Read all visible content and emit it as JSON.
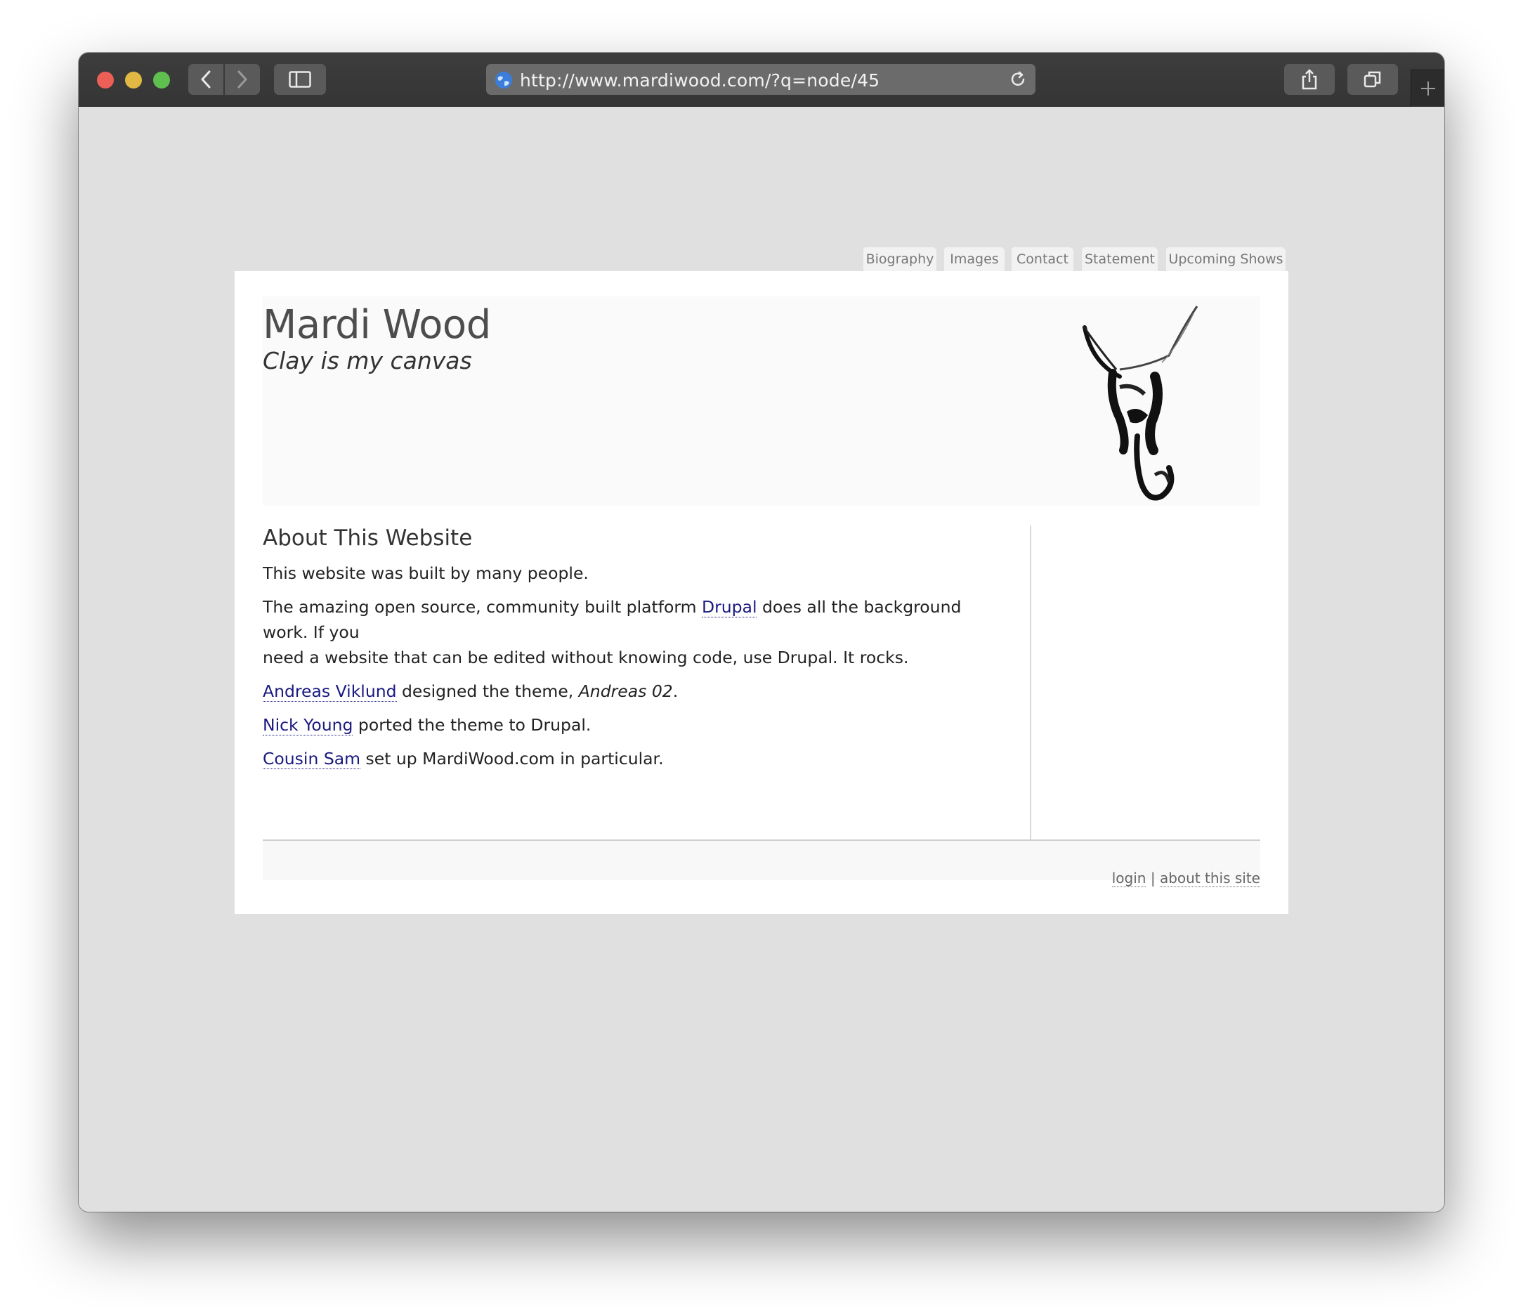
{
  "browser": {
    "url": "http://www.mardiwood.com/?q=node/45"
  },
  "nav": {
    "tabs": [
      "Biography",
      "Images",
      "Contact",
      "Statement",
      "Upcoming Shows"
    ]
  },
  "site": {
    "name": "Mardi Wood",
    "slogan": "Clay is my canvas"
  },
  "article": {
    "title": "About This Website",
    "p1": "This website was built by many people.",
    "p2_before": "The amazing open source, community built platform ",
    "p2_link": "Drupal",
    "p2_after_line1": " does all the background work. If you",
    "p2_line2": "need a website that can be edited without knowing code, use Drupal. It rocks.",
    "p3_link": "Andreas Viklund",
    "p3_mid": " designed the theme, ",
    "p3_em": "Andreas 02",
    "p3_end": ".",
    "p4_link": "Nick Young",
    "p4_after": " ported the theme to Drupal.",
    "p5_link": "Cousin Sam",
    "p5_after": " set up MardiWood.com in particular."
  },
  "footer": {
    "login": "login",
    "separator": "|",
    "about": "about this site"
  },
  "colors": {
    "link": "#1a1a80",
    "page_bg": "#e0e0e0"
  }
}
